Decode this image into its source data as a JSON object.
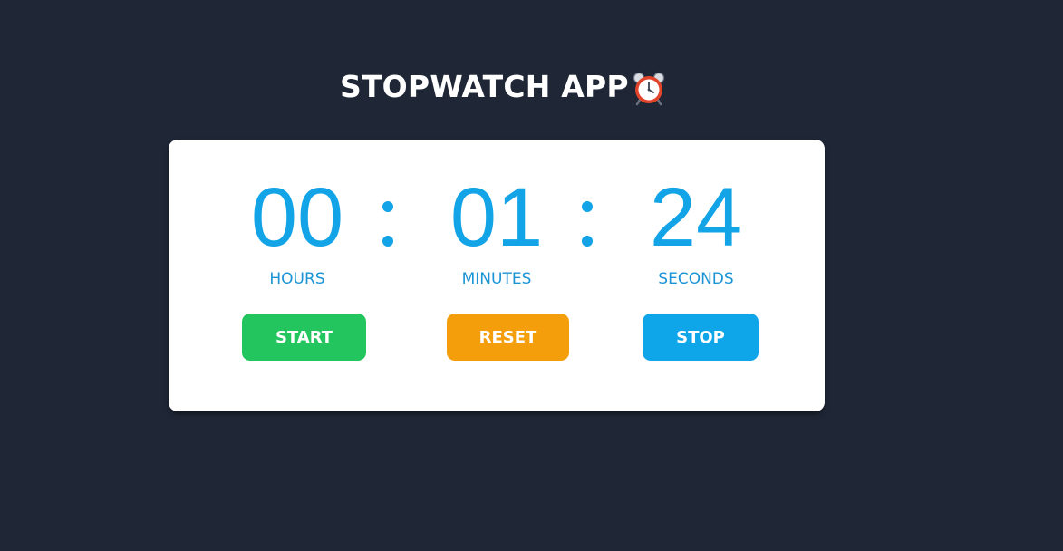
{
  "header": {
    "title": "STOPWATCH APP",
    "icon": "alarm-clock-icon"
  },
  "timer": {
    "hours": "00",
    "minutes": "01",
    "seconds": "24",
    "separator": ":",
    "hours_label": "HOURS",
    "minutes_label": "MINUTES",
    "seconds_label": "SECONDS"
  },
  "controls": {
    "start_label": "START",
    "reset_label": "RESET",
    "stop_label": "STOP"
  },
  "colors": {
    "background": "#1f2737",
    "card": "#ffffff",
    "digits": "#12a4e6",
    "start": "#22c55e",
    "reset": "#f59e0b",
    "stop": "#0ea5e9"
  }
}
